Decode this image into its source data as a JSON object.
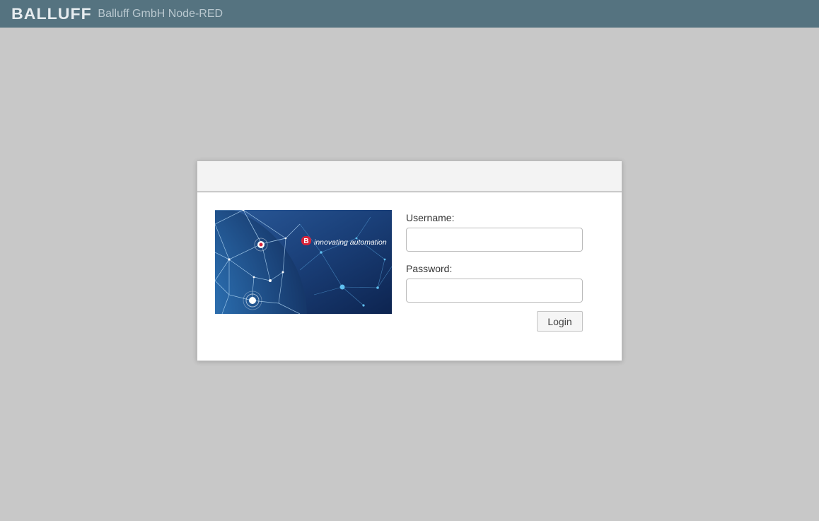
{
  "header": {
    "logo_text": "BALLUFF",
    "app_title": "Balluff GmbH Node-RED",
    "background_color": "#557380"
  },
  "login": {
    "banner": {
      "slogan": "innovating automation",
      "badge_letter": "B",
      "badge_color": "#d8233a"
    },
    "username_label": "Username:",
    "username_value": "",
    "password_label": "Password:",
    "password_value": "",
    "login_button_label": "Login"
  }
}
